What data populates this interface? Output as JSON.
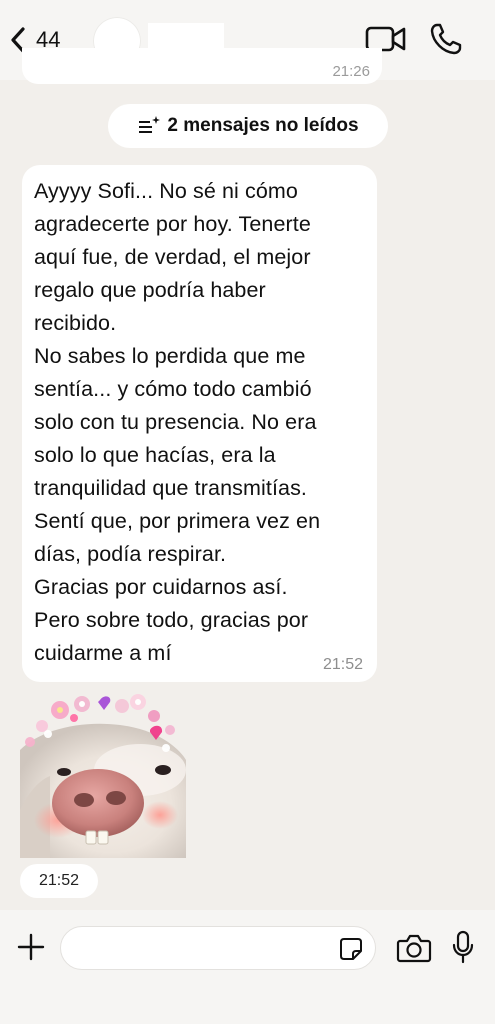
{
  "header": {
    "back_count": "44",
    "icons": {
      "back": "chevron-left-icon",
      "video": "video-camera-icon",
      "call": "phone-icon"
    }
  },
  "previous_message": {
    "time": "21:26"
  },
  "unread_banner": {
    "label": "2 mensajes no leídos",
    "icon": "unread-lines-icon"
  },
  "message": {
    "text": "Ayyyy Sofi... No sé ni cómo\nagradecerte por hoy. Tenerte\naquí fue, de verdad, el mejor\nregalo que podría haber\nrecibido.\nNo sabes lo perdida que me\nsentía... y cómo todo cambió\nsolo con tu presencia. No era\nsolo lo que hacías, era la\ntranquilidad que transmitías.\nSentí que, por primera vez en\ndías, podía respirar.\nGracias por cuidarnos así.\nPero sobre todo, gracias por\ncuidarme a mí",
    "time": "21:52"
  },
  "sticker_message": {
    "time": "21:52",
    "description_icon": "pig-sticker"
  },
  "composer": {
    "placeholder": "",
    "value": "",
    "icons": {
      "plus": "plus-icon",
      "sticker": "sticker-icon",
      "camera": "camera-icon",
      "mic": "microphone-icon"
    }
  },
  "colors": {
    "background": "#f2efeb",
    "bubble": "#ffffff",
    "text": "#111111",
    "timestamp": "#8e8e8e"
  }
}
